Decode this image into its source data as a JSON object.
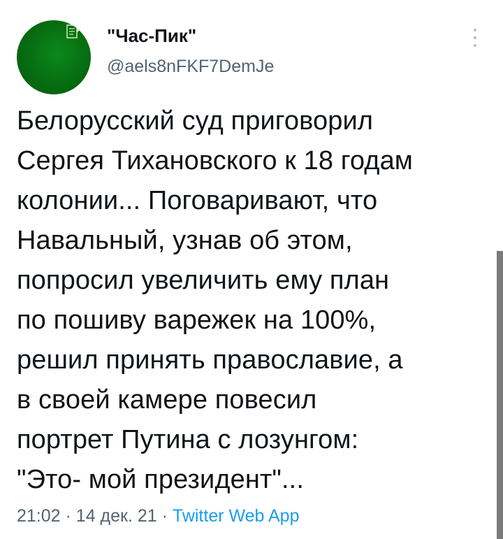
{
  "author": {
    "name": "\"Час-Пик\"",
    "handle": "@aels8nFKF7DemJe",
    "avatar_color": "#077012",
    "avatar_icon": "newspaper-logo-icon"
  },
  "more_icon": "more-vertical-icon",
  "tweet": {
    "lines": [
      "Белорусский суд приговорил",
      "Сергея Тихановского к 18 годам",
      "колонии... Поговаривают, что",
      "Навальный, узнав об этом,",
      "попросил увеличить ему план",
      "по пошиву варежек на 100%,",
      "решил принять православие, а",
      "в своей камере повесил",
      "портрет Путина с лозунгом:",
      "\"Это- мой президент\"..."
    ]
  },
  "meta": {
    "time": "21:02",
    "separator": "·",
    "date": "14 дек. 21",
    "source": "Twitter Web App"
  },
  "colors": {
    "text": "#0f1419",
    "secondary": "#536471",
    "link": "#1d9bf0"
  }
}
